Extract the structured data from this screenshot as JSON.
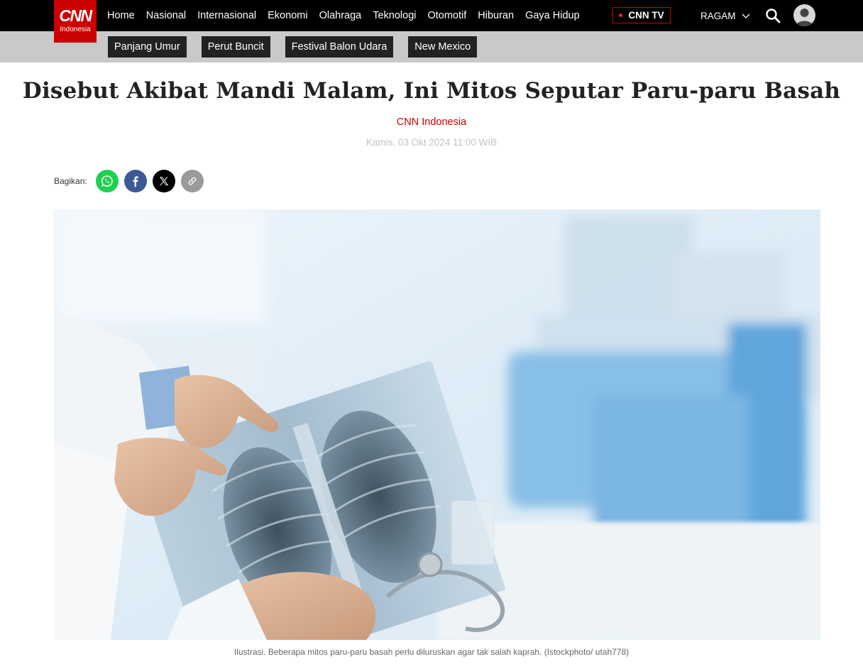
{
  "logo": {
    "text": "CNN",
    "subtext": "Indonesia"
  },
  "nav": {
    "items": [
      "Home",
      "Nasional",
      "Internasional",
      "Ekonomi",
      "Olahraga",
      "Teknologi",
      "Otomotif",
      "Hiburan",
      "Gaya Hidup"
    ],
    "live_label": "CNN TV",
    "ragam_label": "RAGAM",
    "icons": [
      "chevron-down-icon",
      "search-icon",
      "user-avatar-icon"
    ]
  },
  "tags": [
    "Panjang Umur",
    "Perut Buncit",
    "Festival Balon Udara",
    "New Mexico"
  ],
  "article": {
    "title": "Disebut Akibat Mandi Malam, Ini Mitos Seputar Paru-paru Basah",
    "source": "CNN Indonesia",
    "date": "Kamis, 03 Okt 2024 11:00 WIB",
    "share_label": "Bagikan:",
    "share_icons": [
      "whatsapp-icon",
      "facebook-icon",
      "x-icon",
      "link-icon"
    ],
    "image_caption": "Ilustrasi. Beberapa mitos paru-paru basah perlu diluruskan agar tak salah kaprah. (Istockphoto/ utah778)"
  },
  "colors": {
    "brand": "#cc0000",
    "nav_bg": "#000000",
    "tagbar_bg": "#c9c9c9",
    "tag_bg": "#222222",
    "whatsapp": "#1fd050",
    "facebook": "#3b5998"
  }
}
